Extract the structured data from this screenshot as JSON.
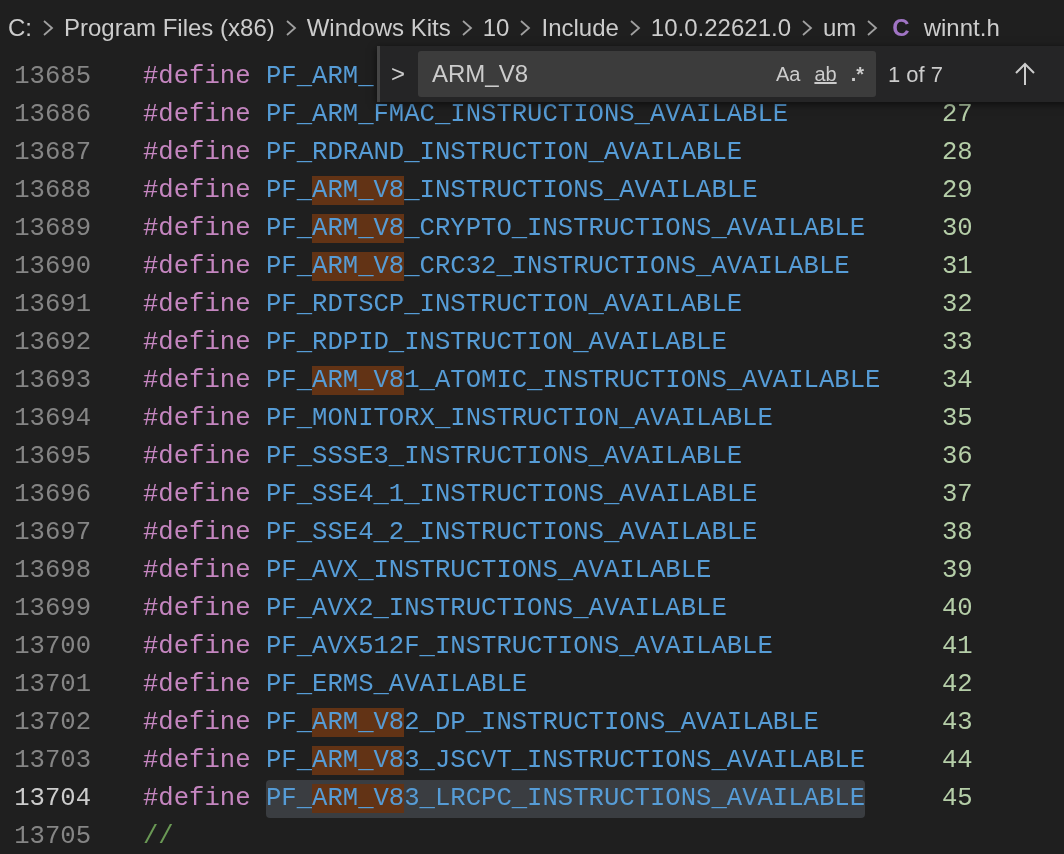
{
  "breadcrumb": {
    "items": [
      "C:",
      "Program Files (x86)",
      "Windows Kits",
      "10",
      "Include",
      "10.0.22621.0",
      "um"
    ],
    "file": {
      "icon": "C",
      "name": "winnt.h"
    }
  },
  "find_widget": {
    "toggle": ">",
    "value": "ARM_V8",
    "options": [
      {
        "label": "Aa",
        "selected": false
      },
      {
        "label": "ab",
        "selected": false
      },
      {
        "label": ".*",
        "selected": false
      }
    ],
    "result": "1 of 7"
  },
  "lines": [
    {
      "num": "13685",
      "kind": "define",
      "keyword": "#define",
      "prefix": "PF_ARM_",
      "selected": false
    },
    {
      "num": "13686",
      "kind": "define",
      "keyword": "#define",
      "prefix": "PF_ARM_FMAC_INSTRUCTIONS_AVAILABLE",
      "value": "27",
      "selected": false
    },
    {
      "num": "13687",
      "kind": "define",
      "keyword": "#define",
      "prefix": "PF_RDRAND_INSTRUCTION_AVAILABLE",
      "value": "28",
      "selected": false
    },
    {
      "num": "13688",
      "kind": "define",
      "keyword": "#define",
      "prefix": "PF_",
      "match": "ARM_V8",
      "rest": "_INSTRUCTIONS_AVAILABLE",
      "value": "29",
      "selected": false
    },
    {
      "num": "13689",
      "kind": "define",
      "keyword": "#define",
      "prefix": "PF_",
      "match": "ARM_V8",
      "rest": "_CRYPTO_INSTRUCTIONS_AVAILABLE",
      "value": "30",
      "selected": false
    },
    {
      "num": "13690",
      "kind": "define",
      "keyword": "#define",
      "prefix": "PF_",
      "match": "ARM_V8",
      "rest": "_CRC32_INSTRUCTIONS_AVAILABLE",
      "value": "31",
      "selected": false
    },
    {
      "num": "13691",
      "kind": "define",
      "keyword": "#define",
      "prefix": "PF_RDTSCP_INSTRUCTION_AVAILABLE",
      "value": "32",
      "selected": false
    },
    {
      "num": "13692",
      "kind": "define",
      "keyword": "#define",
      "prefix": "PF_RDPID_INSTRUCTION_AVAILABLE",
      "value": "33",
      "selected": false
    },
    {
      "num": "13693",
      "kind": "define",
      "keyword": "#define",
      "prefix": "PF_",
      "match": "ARM_V8",
      "rest": "1_ATOMIC_INSTRUCTIONS_AVAILABLE",
      "value": "34",
      "selected": false
    },
    {
      "num": "13694",
      "kind": "define",
      "keyword": "#define",
      "prefix": "PF_MONITORX_INSTRUCTION_AVAILABLE",
      "value": "35",
      "selected": false
    },
    {
      "num": "13695",
      "kind": "define",
      "keyword": "#define",
      "prefix": "PF_SSSE3_INSTRUCTIONS_AVAILABLE",
      "value": "36",
      "selected": false
    },
    {
      "num": "13696",
      "kind": "define",
      "keyword": "#define",
      "prefix": "PF_SSE4_1_INSTRUCTIONS_AVAILABLE",
      "value": "37",
      "selected": false
    },
    {
      "num": "13697",
      "kind": "define",
      "keyword": "#define",
      "prefix": "PF_SSE4_2_INSTRUCTIONS_AVAILABLE",
      "value": "38",
      "selected": false
    },
    {
      "num": "13698",
      "kind": "define",
      "keyword": "#define",
      "prefix": "PF_AVX_INSTRUCTIONS_AVAILABLE",
      "value": "39",
      "selected": false
    },
    {
      "num": "13699",
      "kind": "define",
      "keyword": "#define",
      "prefix": "PF_AVX2_INSTRUCTIONS_AVAILABLE",
      "value": "40",
      "selected": false
    },
    {
      "num": "13700",
      "kind": "define",
      "keyword": "#define",
      "prefix": "PF_AVX512F_INSTRUCTIONS_AVAILABLE",
      "value": "41",
      "selected": false
    },
    {
      "num": "13701",
      "kind": "define",
      "keyword": "#define",
      "prefix": "PF_ERMS_AVAILABLE",
      "value": "42",
      "selected": false
    },
    {
      "num": "13702",
      "kind": "define",
      "keyword": "#define",
      "prefix": "PF_",
      "match": "ARM_V8",
      "rest": "2_DP_INSTRUCTIONS_AVAILABLE",
      "value": "43",
      "selected": false
    },
    {
      "num": "13703",
      "kind": "define",
      "keyword": "#define",
      "prefix": "PF_",
      "match": "ARM_V8",
      "rest": "3_JSCVT_INSTRUCTIONS_AVAILABLE",
      "value": "44",
      "selected": false
    },
    {
      "num": "13704",
      "kind": "define",
      "keyword": "#define",
      "prefix": "PF_",
      "match": "ARM_V8",
      "rest": "3_LRCPC_INSTRUCTIONS_AVAILABLE",
      "value": "45",
      "selected": true
    },
    {
      "num": "13705",
      "kind": "comment",
      "text": "//",
      "selected": false
    }
  ]
}
